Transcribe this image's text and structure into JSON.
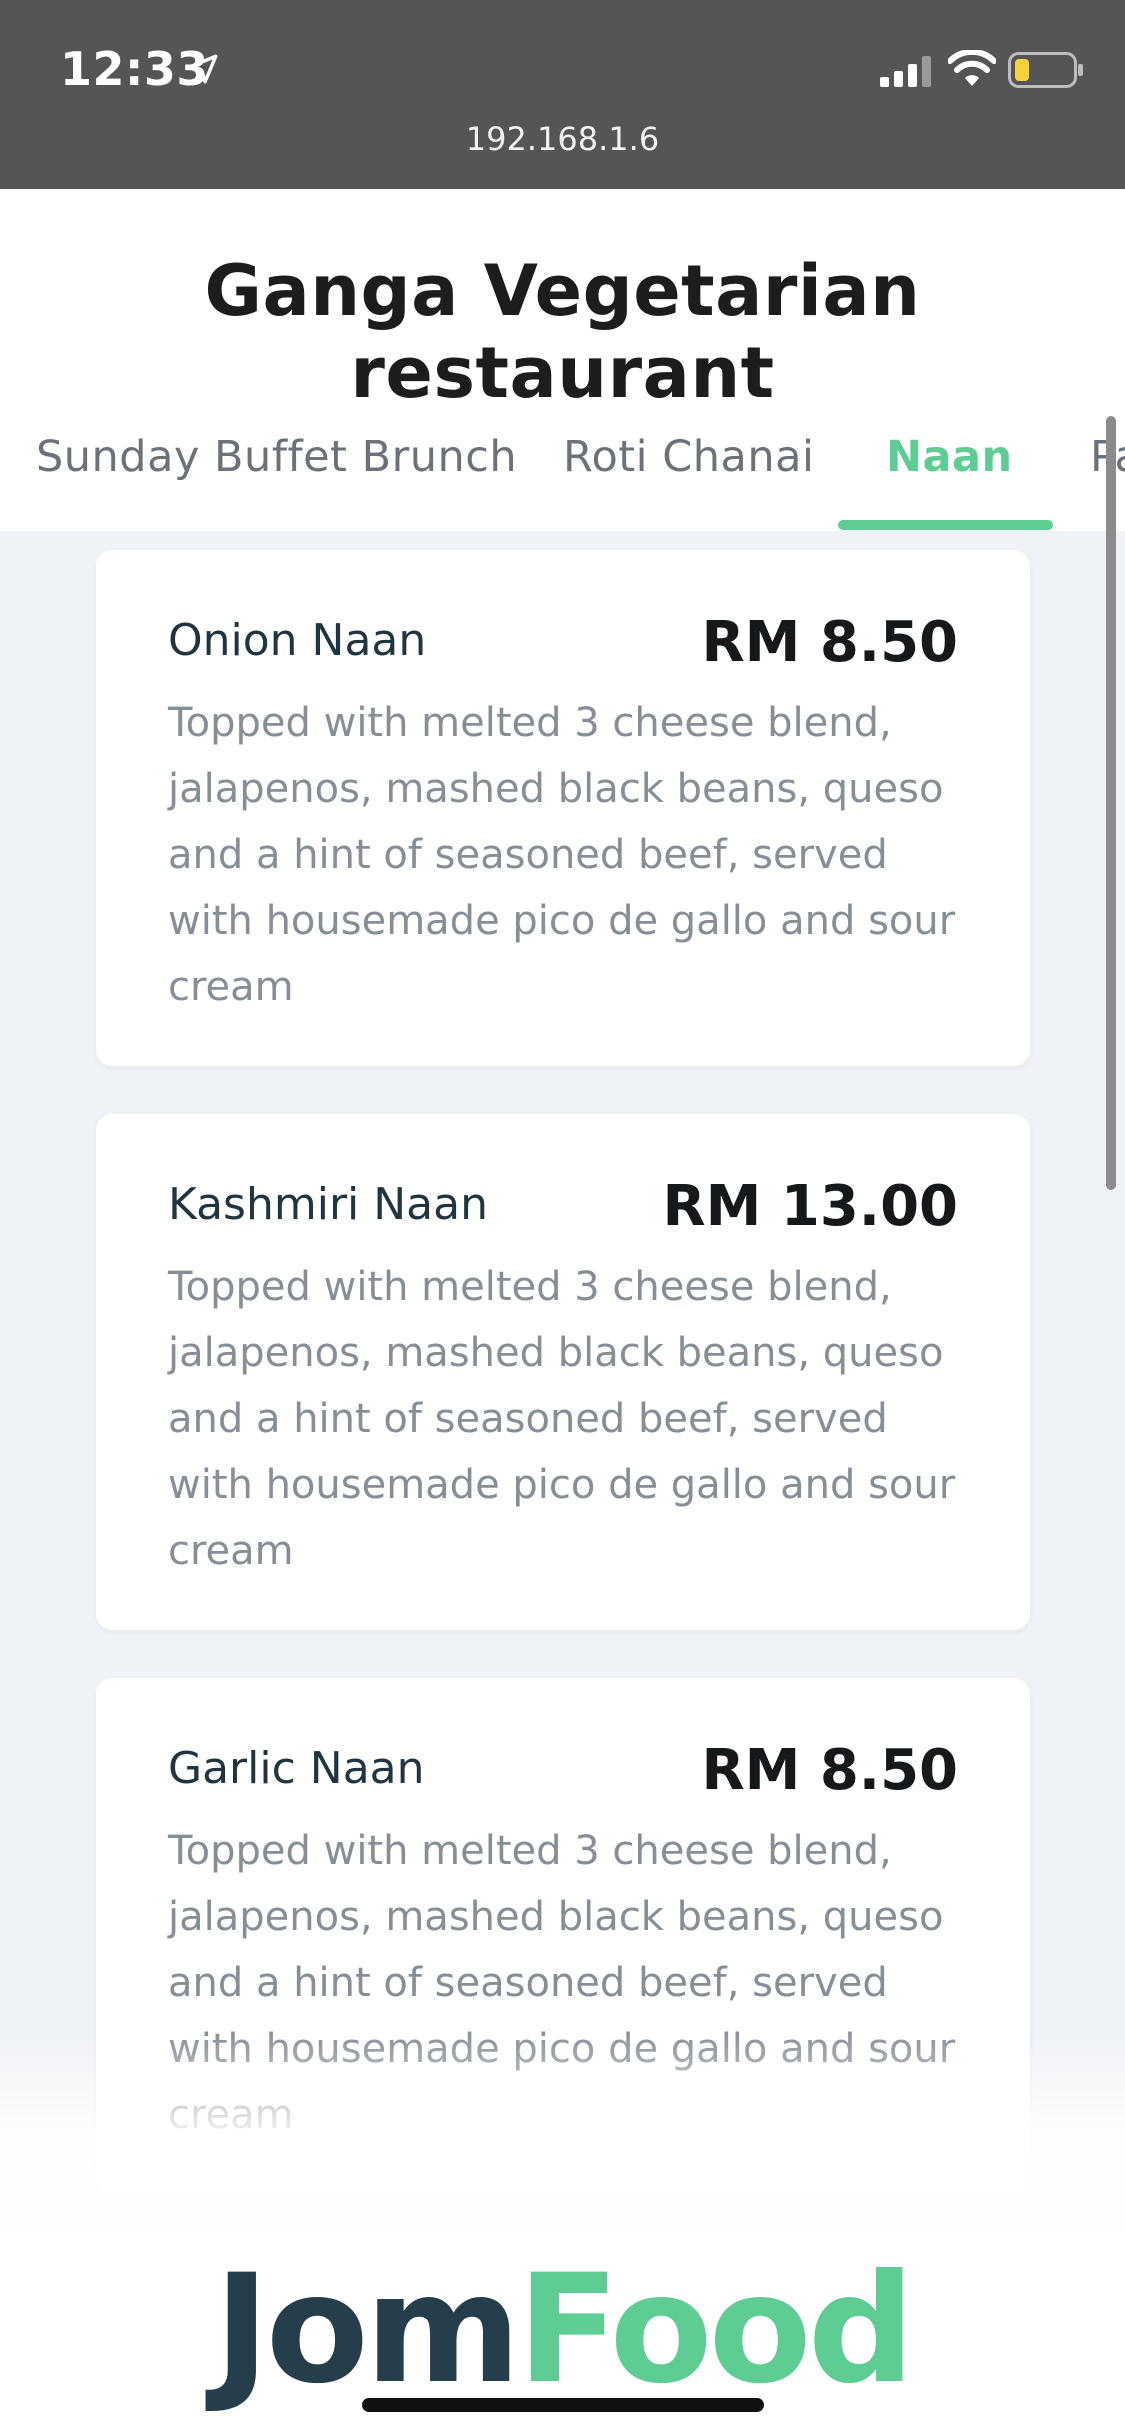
{
  "status_bar": {
    "time": "12:33",
    "url": "192.168.1.6",
    "icons": [
      "location-arrow-icon",
      "cellular-signal-icon",
      "wifi-icon",
      "battery-icon"
    ],
    "battery_color": "#f5d23c"
  },
  "header": {
    "title": "Ganga Vegetarian restaurant"
  },
  "tabs": [
    {
      "label": "Sunday Buffet Brunch",
      "active": false
    },
    {
      "label": "Roti Chanai",
      "active": false
    },
    {
      "label": "Naan",
      "active": true
    },
    {
      "label": "Pa",
      "active": false
    }
  ],
  "menu_items": [
    {
      "name": "Onion Naan",
      "price": "RM 8.50",
      "description": "Topped with melted 3 cheese blend, jalapenos, mashed black beans, queso and a hint of seasoned beef, served with housemade pico de gallo and sour cream"
    },
    {
      "name": "Kashmiri Naan",
      "price": "RM 13.00",
      "description": "Topped with melted 3 cheese blend, jalapenos, mashed black beans, queso and a hint of seasoned beef, served with housemade pico de gallo and sour cream"
    },
    {
      "name": "Garlic Naan",
      "price": "RM 8.50",
      "description": "Topped with melted 3 cheese blend, jalapenos, mashed black beans, queso and a hint of seasoned beef, served with housemade pico de gallo and sour cream"
    }
  ],
  "footer": {
    "logo_part_1": "Jom",
    "logo_part_2": "Food"
  },
  "colors": {
    "accent": "#5ecd93",
    "brand_dark": "#243e4b",
    "status_bar_bg": "#545557",
    "page_bg": "#eff2f6"
  }
}
